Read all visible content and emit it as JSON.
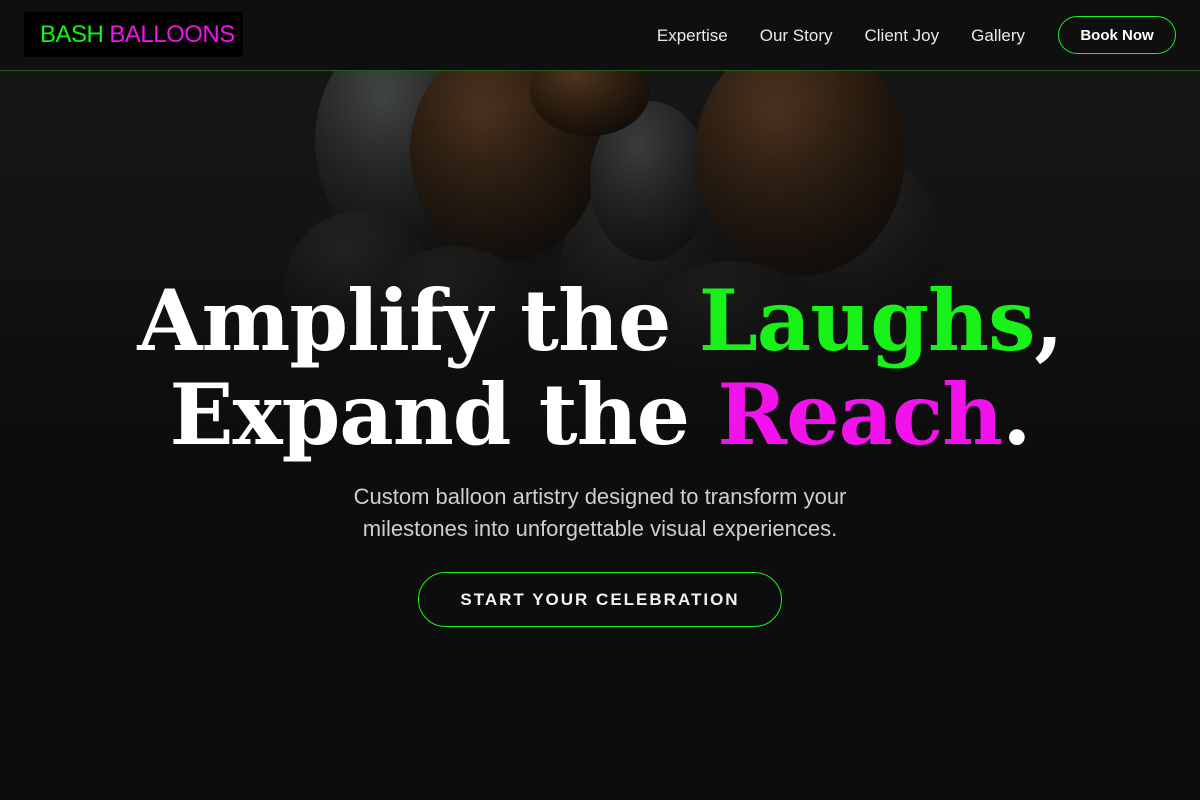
{
  "brand": {
    "word1": "BASH",
    "word2": "BALLOONS"
  },
  "nav": {
    "links": [
      "Expertise",
      "Our Story",
      "Client Joy",
      "Gallery"
    ],
    "cta": "Book Now"
  },
  "hero": {
    "line1_start": "Amplify the ",
    "line1_highlight": "Laughs",
    "line1_end": ",",
    "line2_start": "Expand the ",
    "line2_highlight": "Reach",
    "line2_end": ".",
    "subtitle": "Custom balloon artistry designed to transform your milestones into unforgettable visual experiences.",
    "cta": "START YOUR CELEBRATION"
  },
  "colors": {
    "accent_green": "#19f219",
    "accent_magenta": "#f212ec",
    "background": "#0c0c0c"
  },
  "icons": {
    "hero_image": "balloon-bouquet-image"
  }
}
